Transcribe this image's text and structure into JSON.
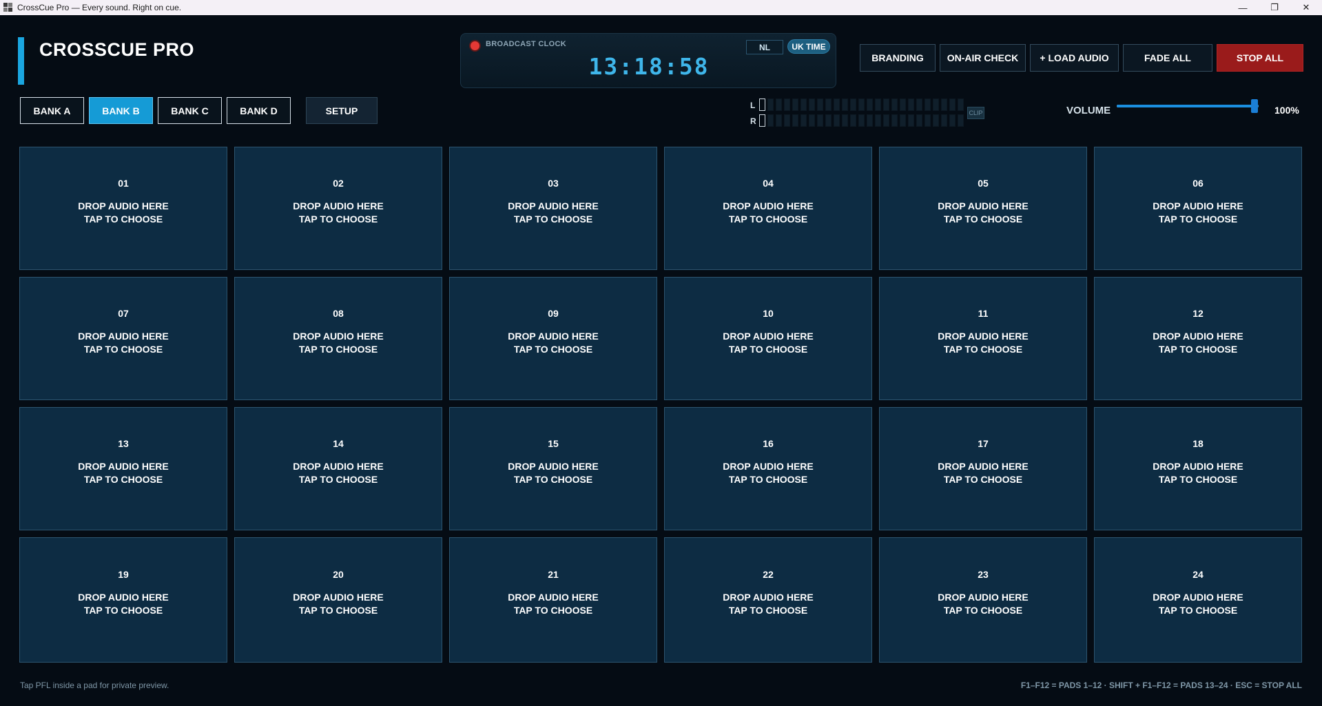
{
  "window": {
    "title": "CrossCue Pro — Every sound. Right on cue.",
    "minimize_glyph": "—",
    "restore_glyph": "❐",
    "close_glyph": "✕"
  },
  "header": {
    "app_name": "CROSSCUE PRO",
    "accent_color": "#1aa6e0"
  },
  "clock": {
    "label": "BROADCAST CLOCK",
    "time": "13:18:58",
    "tz_options": [
      "NL",
      "UK TIME"
    ],
    "tz_selected": "UK TIME"
  },
  "toolbar": {
    "branding": "BRANDING",
    "on_air_check": "ON-AIR CHECK",
    "load_audio": "+ LOAD AUDIO",
    "fade_all": "FADE ALL",
    "stop_all": "STOP ALL",
    "stop_color": "#9a1b1b"
  },
  "banks": {
    "items": [
      "BANK A",
      "BANK B",
      "BANK C",
      "BANK D"
    ],
    "active": "BANK B",
    "setup": "SETUP"
  },
  "meter": {
    "left_label": "L",
    "right_label": "R",
    "clip_label": "CLIP",
    "left_level": 0,
    "right_level": 0
  },
  "volume": {
    "label": "VOLUME",
    "value": "100%",
    "level": 1.0
  },
  "pads": {
    "line1": "DROP AUDIO HERE",
    "line2": "TAP TO CHOOSE",
    "numbers": [
      "01",
      "02",
      "03",
      "04",
      "05",
      "06",
      "07",
      "08",
      "09",
      "10",
      "11",
      "12",
      "13",
      "14",
      "15",
      "16",
      "17",
      "18",
      "19",
      "20",
      "21",
      "22",
      "23",
      "24"
    ]
  },
  "footer": {
    "hint": "Tap PFL inside a pad for private preview.",
    "shortcuts": "F1–F12 = PADS 1–12  ·  SHIFT + F1–F12 = PADS 13–24  ·  ESC = STOP ALL"
  }
}
